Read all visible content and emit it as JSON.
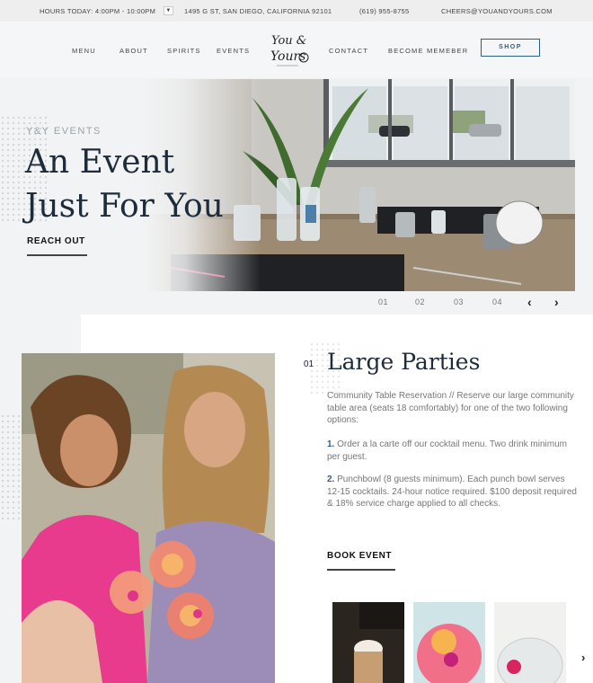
{
  "topbar": {
    "hours": "HOURS TODAY: 4:00PM - 10:00PM",
    "address": "1495 G ST, SAN DIEGO, CALIFORNIA 92101",
    "phone": "(619) 955-8755",
    "email": "CHEERS@YOUANDYOURS.COM"
  },
  "nav": {
    "items": [
      "MENU",
      "ABOUT",
      "SPIRITS",
      "EVENTS",
      "CONTACT",
      "BECOME MEMEBER"
    ],
    "shop": "SHOP",
    "logo_top": "You &",
    "logo_bottom": "Yours"
  },
  "hero": {
    "kicker": "Y&Y EVENTS",
    "title_line1": "An Event",
    "title_line2": "Just For You",
    "cta": "REACH OUT",
    "pager": [
      "01",
      "02",
      "03",
      "04"
    ]
  },
  "section": {
    "number": "01",
    "title": "Large Parties",
    "intro": "Community Table Reservation // Reserve our large community table area (seats 18 comfortably) for one of the two following options:",
    "option1_num": "1.",
    "option1": "Order a la carte off our cocktail menu. Two drink minimum per guest.",
    "option2_num": "2.",
    "option2": "Punchbowl (8 guests minimum). Each punch bowl serves 12-15 cocktails. 24-hour notice required. $100 deposit required & 18% service charge applied to all checks.",
    "cta": "BOOK EVENT"
  },
  "colors": {
    "accent": "#2a5f8a",
    "heading": "#1d2b3a",
    "body_text": "#777777",
    "bar_bg": "#eeeeee"
  }
}
